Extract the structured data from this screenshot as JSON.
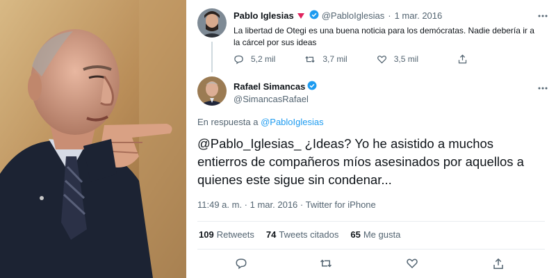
{
  "quoted_tweet": {
    "author_name": "Pablo Iglesias",
    "handle": "@PabloIglesias",
    "separator": "·",
    "date": "1 mar. 2016",
    "text": "La libertad de Otegi es una buena noticia para los demócratas. Nadie debería ir a la cárcel por sus ideas",
    "reply_count": "5,2 mil",
    "retweet_count": "3,7 mil",
    "like_count": "3,5 mil",
    "more_label": "ooo"
  },
  "main_tweet": {
    "author_name": "Rafael Simancas",
    "handle": "@SimancasRafael",
    "more_label": "ooo",
    "reply_prefix": "En respuesta a",
    "reply_to": "@PabloIglesias",
    "text": "@Pablo_Iglesias_ ¿Ideas? Yo he asistido a muchos entierros de compañeros míos asesinados por aquellos a quienes este sigue sin condenar...",
    "meta": "11:49 a. m. · 1 mar. 2016 · Twitter for iPhone",
    "retweets_value": "109",
    "retweets_label": "Retweets",
    "quotes_value": "74",
    "quotes_label": "Tweets citados",
    "likes_value": "65",
    "likes_label": "Me gusta"
  },
  "colors": {
    "accent": "#1d9bf0",
    "muted": "#536471",
    "party_badge": "#e0245e",
    "text": "#0f1419"
  },
  "icons": [
    "reply-icon",
    "retweet-icon",
    "like-icon",
    "share-icon",
    "verified-badge-icon",
    "more-options-icon"
  ]
}
